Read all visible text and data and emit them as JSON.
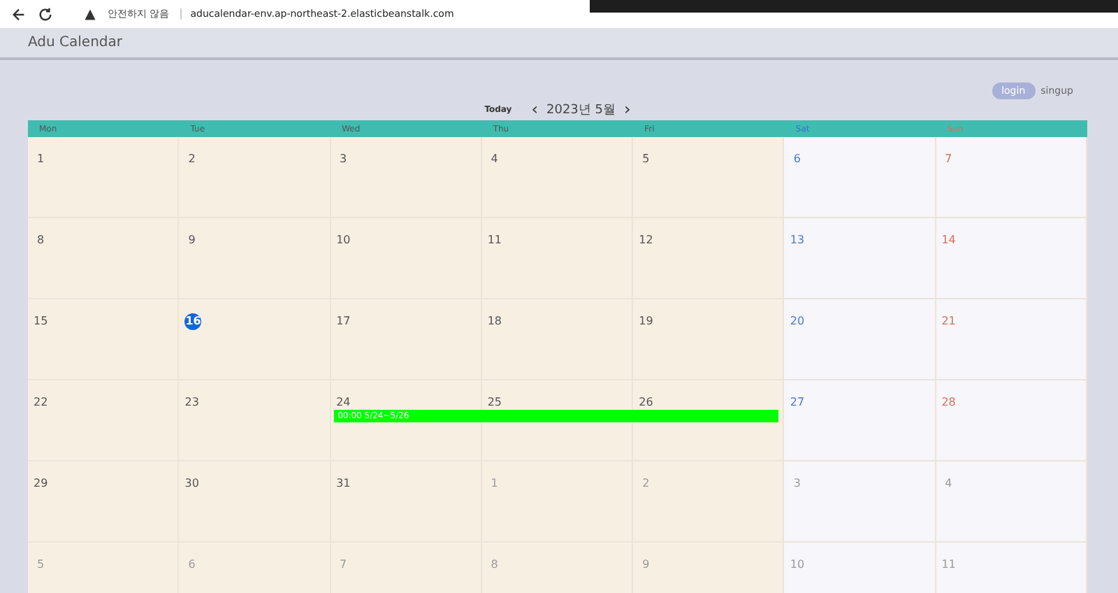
{
  "browser": {
    "security": "안전하지 않음",
    "url": "aducalendar-env.ap-northeast-2.elasticbeanstalk.com"
  },
  "app": {
    "title": "Adu Calendar"
  },
  "auth": {
    "login": "login",
    "signup": "singup"
  },
  "nav": {
    "today": "Today",
    "prev": "‹",
    "month": "2023년 5월",
    "next": "›"
  },
  "weekdays": [
    {
      "label": "Mon",
      "kind": "weekday"
    },
    {
      "label": "Tue",
      "kind": "weekday"
    },
    {
      "label": "Wed",
      "kind": "weekday"
    },
    {
      "label": "Thu",
      "kind": "weekday"
    },
    {
      "label": "Fri",
      "kind": "weekday"
    },
    {
      "label": "Sat",
      "kind": "sat"
    },
    {
      "label": "Sun",
      "kind": "sun"
    }
  ],
  "weeks": [
    {
      "days": [
        {
          "day": "1",
          "current": true
        },
        {
          "day": "2",
          "current": true
        },
        {
          "day": "3",
          "current": true
        },
        {
          "day": "4",
          "current": true
        },
        {
          "day": "5",
          "current": true
        },
        {
          "day": "6",
          "current": true
        },
        {
          "day": "7",
          "current": true
        }
      ]
    },
    {
      "days": [
        {
          "day": "8",
          "current": true
        },
        {
          "day": "9",
          "current": true
        },
        {
          "day": "10",
          "current": true
        },
        {
          "day": "11",
          "current": true
        },
        {
          "day": "12",
          "current": true
        },
        {
          "day": "13",
          "current": true
        },
        {
          "day": "14",
          "current": true
        }
      ]
    },
    {
      "days": [
        {
          "day": "15",
          "current": true
        },
        {
          "day": "16",
          "current": true,
          "today": true
        },
        {
          "day": "17",
          "current": true
        },
        {
          "day": "18",
          "current": true
        },
        {
          "day": "19",
          "current": true
        },
        {
          "day": "20",
          "current": true
        },
        {
          "day": "21",
          "current": true
        }
      ]
    },
    {
      "days": [
        {
          "day": "22",
          "current": true
        },
        {
          "day": "23",
          "current": true
        },
        {
          "day": "24",
          "current": true,
          "event": true
        },
        {
          "day": "25",
          "current": true,
          "event": true
        },
        {
          "day": "26",
          "current": true,
          "event": true
        },
        {
          "day": "27",
          "current": true
        },
        {
          "day": "28",
          "current": true
        }
      ],
      "events": [
        {
          "label": "00:00 5/24~5/26",
          "color": "#00ff00"
        }
      ]
    },
    {
      "days": [
        {
          "day": "29",
          "current": true
        },
        {
          "day": "30",
          "current": true
        },
        {
          "day": "31",
          "current": true
        },
        {
          "day": "1",
          "current": false
        },
        {
          "day": "2",
          "current": false
        },
        {
          "day": "3",
          "current": false
        },
        {
          "day": "4",
          "current": false
        }
      ]
    },
    {
      "days": [
        {
          "day": "5",
          "current": false
        },
        {
          "day": "6",
          "current": false
        },
        {
          "day": "7",
          "current": false
        },
        {
          "day": "8",
          "current": false
        },
        {
          "day": "9",
          "current": false
        },
        {
          "day": "10",
          "current": false
        },
        {
          "day": "11",
          "current": false
        }
      ]
    }
  ]
}
